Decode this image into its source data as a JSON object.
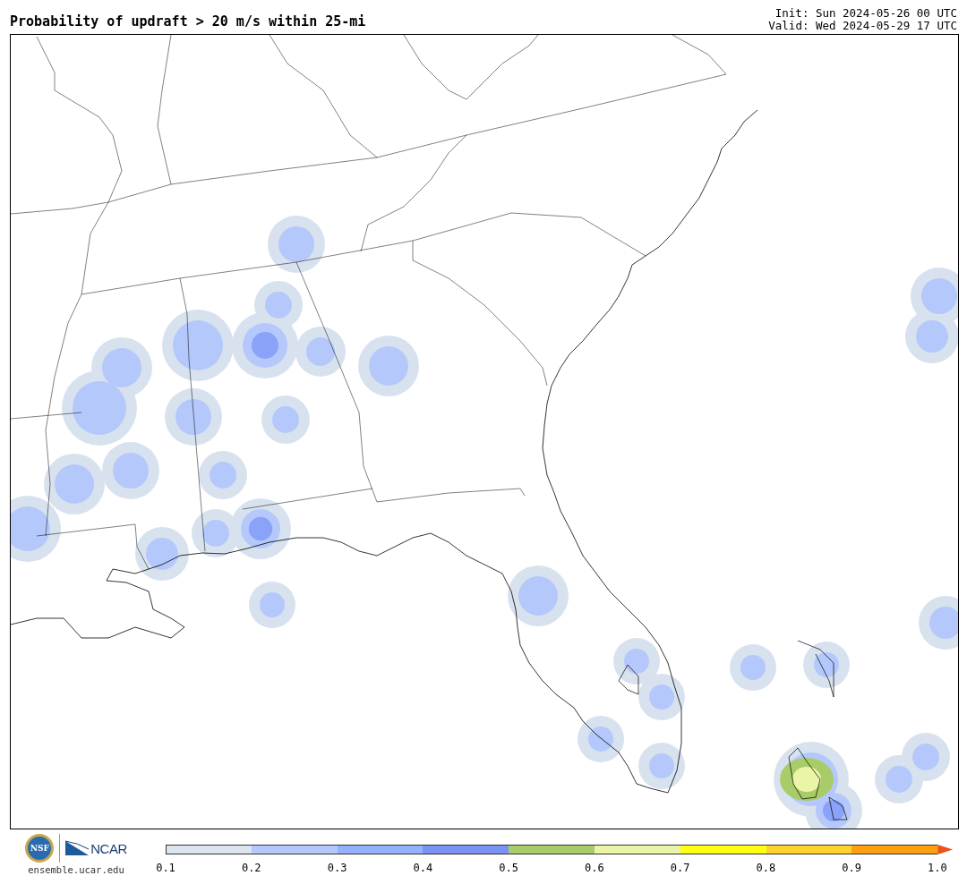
{
  "header": {
    "title": "Probability of updraft > 20 m/s within 25-mi",
    "init": "Init: Sun 2024-05-26 00 UTC",
    "valid": "Valid: Wed 2024-05-29 17 UTC"
  },
  "footer": {
    "logo_left": "NSF",
    "logo_right": "NCAR",
    "site": "ensemble.ucar.edu"
  },
  "colorbar": {
    "bins": [
      {
        "color": "#dbe4ef"
      },
      {
        "color": "#b4c8fb"
      },
      {
        "color": "#93b2fb"
      },
      {
        "color": "#7b93f5"
      },
      {
        "color": "#a8cc68"
      },
      {
        "color": "#eaf5a8"
      },
      {
        "color": "#ffff14"
      },
      {
        "color": "#ffd22c"
      },
      {
        "color": "#ff9f0e"
      },
      {
        "kind": "arrow",
        "color": "#e8541b"
      }
    ],
    "ticks": [
      "0.1",
      "0.2",
      "0.3",
      "0.4",
      "0.5",
      "0.6",
      "0.7",
      "0.8",
      "0.9",
      "1.0"
    ]
  }
}
